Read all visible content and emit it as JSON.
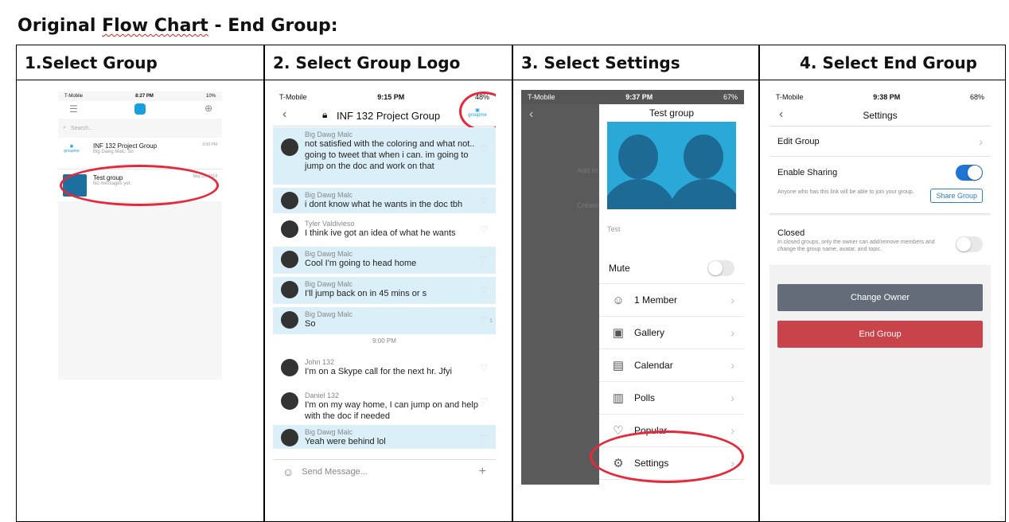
{
  "doc_title": {
    "prefix": "Original ",
    "squiggle": "Flow Chart",
    "suffix": " - End Group:"
  },
  "headers": [
    "1.Select Group",
    "2. Select Group Logo",
    "3. Select Settings",
    "4. Select End Group"
  ],
  "phone1": {
    "status": {
      "carrier": "T-Mobile",
      "time": "8:27 PM",
      "battery": "10%"
    },
    "search_placeholder": "Search...",
    "groups": [
      {
        "name": "INF 132 Project Group",
        "preview": "Big Dawg Malc: So",
        "time": "9:50 PM",
        "logo": "groupme"
      },
      {
        "name": "Test group",
        "preview": "No messages yet.",
        "time": "May 29, 2018"
      }
    ]
  },
  "phone2": {
    "status": {
      "carrier": "T-Mobile",
      "time": "9:15 PM",
      "battery": "48%"
    },
    "title": "INF 132 Project Group",
    "logo": "groupme",
    "messages": [
      {
        "who": "Big Dawg Malc",
        "text": "not satisfied with the coloring and what not.. going to tweet that when i can. im going to jump on the doc and work on that",
        "blue": true
      },
      {
        "who": "Big Dawg Malc",
        "text": "i dont know what he wants in the doc tbh",
        "blue": true
      },
      {
        "who": "Tyler Valdivieso",
        "text": "I think ive got an idea of what he wants",
        "blue": false
      },
      {
        "who": "Big Dawg Malc",
        "text": "Cool I'm going to head home",
        "blue": true
      },
      {
        "who": "Big Dawg Malc",
        "text": "I'll jump back on in 45 mins or s",
        "blue": true
      },
      {
        "who": "Big Dawg Malc",
        "text": "So",
        "blue": true,
        "likes": "1"
      },
      {
        "who": "John 132",
        "text": "I'm on a Skype call for the next hr. Jfyi",
        "blue": false
      },
      {
        "who": "Daniel 132",
        "text": "I'm on my way home, I can jump on and help with the doc if needed",
        "blue": false
      },
      {
        "who": "Big Dawg Malc",
        "text": "Yeah were behind lol",
        "blue": true
      }
    ],
    "time_divider": "9:00 PM",
    "input_placeholder": "Send Message..."
  },
  "phone3": {
    "status": {
      "carrier": "T-Mobile",
      "time": "9:37 PM",
      "battery": "67%"
    },
    "title": "Test group",
    "caption": "Test",
    "bg_labels": [
      "Add m",
      "Create"
    ],
    "mute_label": "Mute",
    "menu": [
      {
        "icon": "members-icon",
        "glyph": "☺",
        "label": "1 Member"
      },
      {
        "icon": "gallery-icon",
        "glyph": "▣",
        "label": "Gallery"
      },
      {
        "icon": "calendar-icon",
        "glyph": "▤",
        "label": "Calendar"
      },
      {
        "icon": "polls-icon",
        "glyph": "▥",
        "label": "Polls"
      },
      {
        "icon": "popular-icon",
        "glyph": "♡",
        "label": "Popular"
      },
      {
        "icon": "settings-icon",
        "glyph": "⚙",
        "label": "Settings"
      }
    ]
  },
  "phone4": {
    "status": {
      "carrier": "T-Mobile",
      "time": "9:38 PM",
      "battery": "68%"
    },
    "title": "Settings",
    "edit_group": "Edit Group",
    "enable_sharing": "Enable Sharing",
    "sharing_desc": "Anyone who has this link will be able to join your group.",
    "share_button": "Share Group",
    "closed_label": "Closed",
    "closed_desc": "In closed groups, only the owner can add/remove members and change the group name, avatar, and topic.",
    "change_owner": "Change Owner",
    "end_group": "End Group"
  },
  "colors": {
    "ring": "#e8283a",
    "groupme_blue": "#1a9fde",
    "toggle_on": "#1f74d4",
    "change_owner": "#636c78",
    "end_group": "#c9434a",
    "chat_blue": "#dbeff8"
  }
}
